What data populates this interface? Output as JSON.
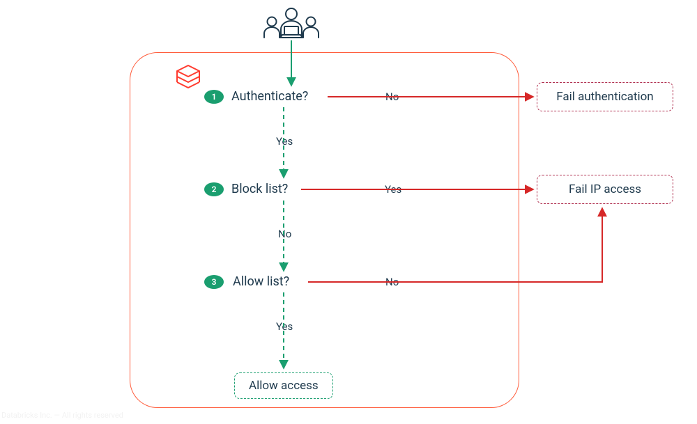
{
  "steps": [
    {
      "num": "1",
      "question": "Authenticate?",
      "yes": "Yes",
      "no": "No"
    },
    {
      "num": "2",
      "question": "Block list?",
      "yes": "Yes",
      "no": "No"
    },
    {
      "num": "3",
      "question": "Allow list?",
      "yes": "Yes",
      "no": "No"
    }
  ],
  "outcomes": {
    "fail_auth": "Fail authentication",
    "fail_ip": "Fail IP access",
    "allow": "Allow access"
  },
  "copyright": "Databricks Inc. — All rights reserved"
}
